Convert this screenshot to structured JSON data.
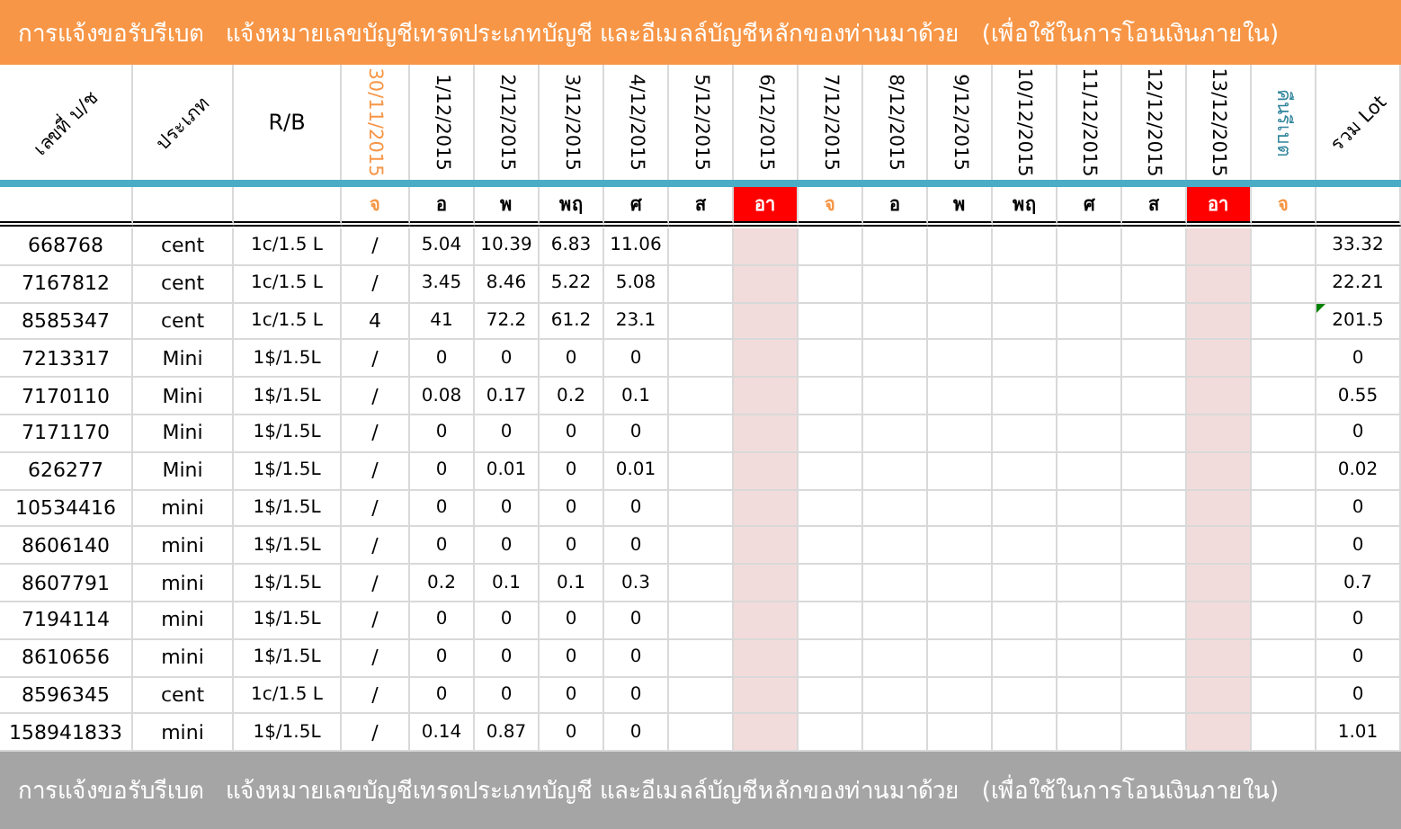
{
  "banner": {
    "title": "การแจ้งขอรับรีเบต   แจ้งหมายเลขบัญชีเทรดประเภทบัญชี และอีเมลล์บัญชีหลักของท่านมาด้วย   (เพื่อใช้ในการโอนเงินภายใน)"
  },
  "columns": [
    {
      "label": "เลขที่ บ/ช",
      "kind": "diagonal",
      "color": "#000000"
    },
    {
      "label": "ประเภท",
      "kind": "diagonal",
      "color": "#000000"
    },
    {
      "label": "R/B",
      "kind": "flat",
      "color": "#000000"
    },
    {
      "label": "30/11/2015",
      "kind": "vertical",
      "color": "#f79646"
    },
    {
      "label": "1/12/2015",
      "kind": "vertical",
      "color": "#000000"
    },
    {
      "label": "2/12/2015",
      "kind": "vertical",
      "color": "#000000"
    },
    {
      "label": "3/12/2015",
      "kind": "vertical",
      "color": "#000000"
    },
    {
      "label": "4/12/2015",
      "kind": "vertical",
      "color": "#000000"
    },
    {
      "label": "5/12/2015",
      "kind": "vertical",
      "color": "#000000"
    },
    {
      "label": "6/12/2015",
      "kind": "vertical",
      "color": "#000000"
    },
    {
      "label": "7/12/2015",
      "kind": "vertical",
      "color": "#000000"
    },
    {
      "label": "8/12/2015",
      "kind": "vertical",
      "color": "#000000"
    },
    {
      "label": "9/12/2015",
      "kind": "vertical",
      "color": "#000000"
    },
    {
      "label": "10/12/2015",
      "kind": "vertical",
      "color": "#000000"
    },
    {
      "label": "11/12/2015",
      "kind": "vertical",
      "color": "#000000"
    },
    {
      "label": "12/12/2015",
      "kind": "vertical",
      "color": "#000000"
    },
    {
      "label": "13/12/2015",
      "kind": "vertical",
      "color": "#000000"
    },
    {
      "label": "คืนรีเบต",
      "kind": "vertical",
      "color": "#31859c"
    },
    {
      "label": "รวม Lot",
      "kind": "diagonal",
      "color": "#000000"
    }
  ],
  "days": [
    {
      "label": "จ",
      "color": "#f79646",
      "holiday": false
    },
    {
      "label": "อ",
      "color": "#000000",
      "holiday": false
    },
    {
      "label": "พ",
      "color": "#000000",
      "holiday": false
    },
    {
      "label": "พฤ",
      "color": "#000000",
      "holiday": false
    },
    {
      "label": "ศ",
      "color": "#000000",
      "holiday": false
    },
    {
      "label": "ส",
      "color": "#000000",
      "holiday": false
    },
    {
      "label": "อา",
      "color": "#ffffff",
      "holiday": true
    },
    {
      "label": "จ",
      "color": "#f79646",
      "holiday": false
    },
    {
      "label": "อ",
      "color": "#000000",
      "holiday": false
    },
    {
      "label": "พ",
      "color": "#000000",
      "holiday": false
    },
    {
      "label": "พฤ",
      "color": "#000000",
      "holiday": false
    },
    {
      "label": "ศ",
      "color": "#000000",
      "holiday": false
    },
    {
      "label": "ส",
      "color": "#000000",
      "holiday": false
    },
    {
      "label": "อา",
      "color": "#ffffff",
      "holiday": true
    },
    {
      "label": "จ",
      "color": "#f79646",
      "holiday": false
    }
  ],
  "rows": [
    {
      "account": "668768",
      "type": "cent",
      "rb": "1c/1.5 L",
      "mark": "/",
      "values": [
        "5.04",
        "10.39",
        "6.83",
        "11.06"
      ],
      "total": "33.32",
      "flagged": false
    },
    {
      "account": "7167812",
      "type": "cent",
      "rb": "1c/1.5 L",
      "mark": "/",
      "values": [
        "3.45",
        "8.46",
        "5.22",
        "5.08"
      ],
      "total": "22.21",
      "flagged": false
    },
    {
      "account": "8585347",
      "type": "cent",
      "rb": "1c/1.5 L",
      "mark": "4",
      "values": [
        "41",
        "72.2",
        "61.2",
        "23.1"
      ],
      "total": "201.5",
      "flagged": true
    },
    {
      "account": "7213317",
      "type": "Mini",
      "rb": "1$/1.5L",
      "mark": "/",
      "values": [
        "0",
        "0",
        "0",
        "0"
      ],
      "total": "0",
      "flagged": false
    },
    {
      "account": "7170110",
      "type": "Mini",
      "rb": "1$/1.5L",
      "mark": "/",
      "values": [
        "0.08",
        "0.17",
        "0.2",
        "0.1"
      ],
      "total": "0.55",
      "flagged": false
    },
    {
      "account": "7171170",
      "type": "Mini",
      "rb": "1$/1.5L",
      "mark": "/",
      "values": [
        "0",
        "0",
        "0",
        "0"
      ],
      "total": "0",
      "flagged": false
    },
    {
      "account": "626277",
      "type": "Mini",
      "rb": "1$/1.5L",
      "mark": "/",
      "values": [
        "0",
        "0.01",
        "0",
        "0.01"
      ],
      "total": "0.02",
      "flagged": false
    },
    {
      "account": "10534416",
      "type": "mini",
      "rb": "1$/1.5L",
      "mark": "/",
      "values": [
        "0",
        "0",
        "0",
        "0"
      ],
      "total": "0",
      "flagged": false
    },
    {
      "account": "8606140",
      "type": "mini",
      "rb": "1$/1.5L",
      "mark": "/",
      "values": [
        "0",
        "0",
        "0",
        "0"
      ],
      "total": "0",
      "flagged": false
    },
    {
      "account": "8607791",
      "type": "mini",
      "rb": "1$/1.5L",
      "mark": "/",
      "values": [
        "0.2",
        "0.1",
        "0.1",
        "0.3"
      ],
      "total": "0.7",
      "flagged": false
    },
    {
      "account": "7194114",
      "type": "mini",
      "rb": "1$/1.5L",
      "mark": "/",
      "values": [
        "0",
        "0",
        "0",
        "0"
      ],
      "total": "0",
      "flagged": false
    },
    {
      "account": "8610656",
      "type": "mini",
      "rb": "1$/1.5L",
      "mark": "/",
      "values": [
        "0",
        "0",
        "0",
        "0"
      ],
      "total": "0",
      "flagged": false
    },
    {
      "account": "8596345",
      "type": "cent",
      "rb": "1c/1.5 L",
      "mark": "/",
      "values": [
        "0",
        "0",
        "0",
        "0"
      ],
      "total": "0",
      "flagged": false
    },
    {
      "account": "158941833",
      "type": "mini",
      "rb": "1$/1.5L",
      "mark": "/",
      "values": [
        "0.14",
        "0.87",
        "0",
        "0"
      ],
      "total": "1.01",
      "flagged": false
    }
  ],
  "footer": {
    "title": "การแจ้งขอรับรีเบต   แจ้งหมายเลขบัญชีเทรดประเภทบัญชี และอีเมลล์บัญชีหลักของท่านมาด้วย   (เพื่อใช้ในการโอนเงินภายใน)"
  }
}
